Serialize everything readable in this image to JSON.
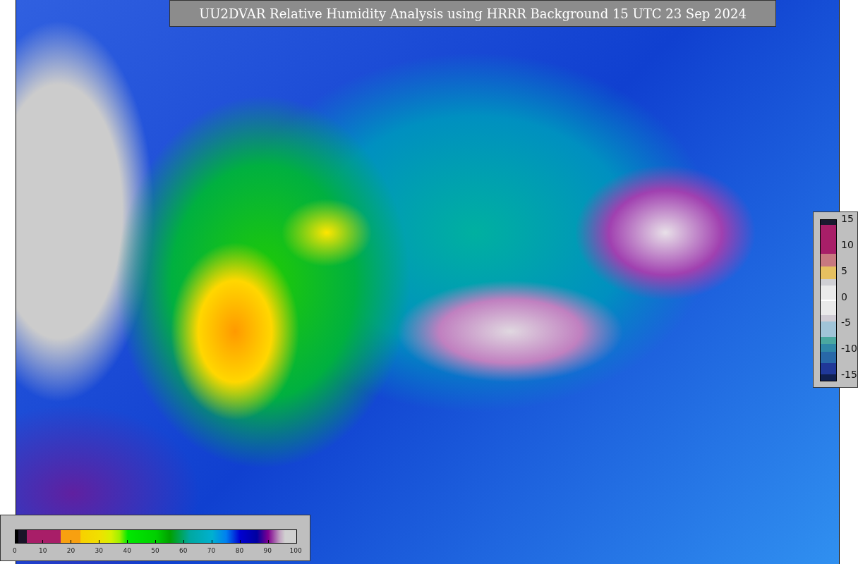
{
  "title": "UU2DVAR Relative Humidity Analysis using HRRR Background 15 UTC 23 Sep 2024",
  "humidity_legend": {
    "ticks": [
      "0",
      "10",
      "20",
      "30",
      "40",
      "50",
      "60",
      "70",
      "80",
      "90",
      "100"
    ]
  },
  "difference_legend": {
    "ticks": [
      "15",
      "10",
      "5",
      "0",
      "-5",
      "-10",
      "-15"
    ]
  }
}
